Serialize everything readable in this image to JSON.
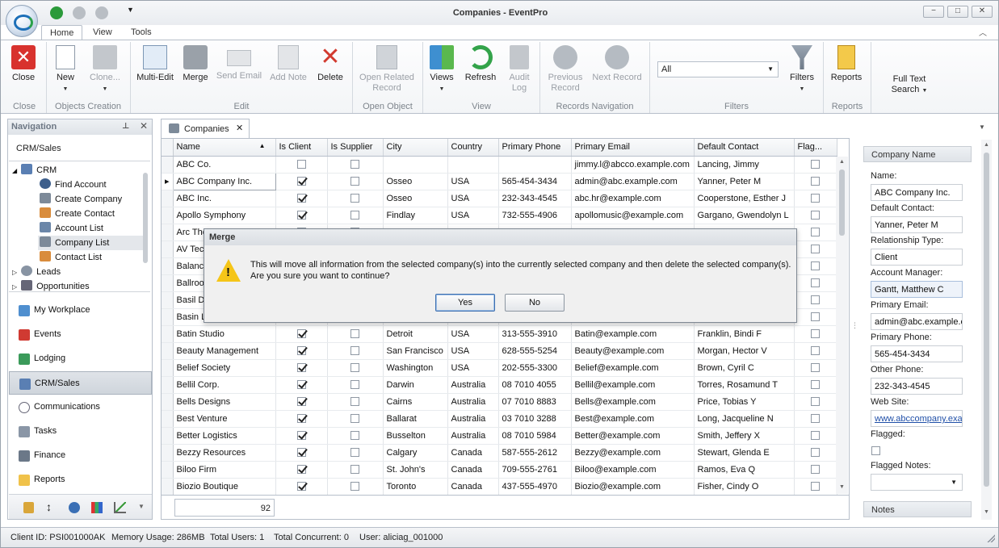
{
  "window": {
    "title": "Companies - EventPro",
    "minimize": "−",
    "restore": "□",
    "close": "✕"
  },
  "ribbon_tabs": [
    "Home",
    "View",
    "Tools"
  ],
  "ribbon": {
    "close": "Close",
    "new": "New",
    "clone": "Clone...",
    "multi_edit": "Multi-Edit",
    "merge": "Merge",
    "send_email": "Send Email",
    "add_note": "Add Note",
    "delete": "Delete",
    "open_related_1": "Open Related",
    "open_related_2": "Record",
    "views": "Views",
    "refresh": "Refresh",
    "audit_1": "Audit",
    "audit_2": "Log",
    "prev_1": "Previous",
    "prev_2": "Record",
    "next_1": "Next Record",
    "filter_value": "All",
    "filters": "Filters",
    "reports": "Reports",
    "fts_1": "Full Text",
    "fts_2": "Search",
    "groups": {
      "close": "Close",
      "objects": "Objects Creation",
      "edit": "Edit",
      "open": "Open Object",
      "view": "View",
      "nav": "Records Navigation",
      "filters": "Filters",
      "reports": "Reports"
    }
  },
  "navigation": {
    "title": "Navigation",
    "section": "CRM/Sales",
    "tree": {
      "crm": "CRM",
      "find_account": "Find Account",
      "create_company": "Create Company",
      "create_contact": "Create Contact",
      "account_list": "Account List",
      "company_list": "Company List",
      "contact_list": "Contact List",
      "leads": "Leads",
      "opportunities": "Opportunities"
    },
    "buttons": {
      "workplace": "My Workplace",
      "events": "Events",
      "lodging": "Lodging",
      "crm": "CRM/Sales",
      "communications": "Communications",
      "tasks": "Tasks",
      "finance": "Finance",
      "reports": "Reports"
    }
  },
  "doc_tab": "Companies",
  "grid": {
    "columns": [
      "Name",
      "Is Client",
      "Is Supplier",
      "City",
      "Country",
      "Primary Phone",
      "Primary Email",
      "Default Contact",
      "Flag..."
    ],
    "rows": [
      {
        "name": "ABC Co.",
        "client": false,
        "supplier": false,
        "city": "",
        "country": "",
        "phone": "",
        "email": "jimmy.l@abcco.example.com",
        "contact": "Lancing, Jimmy"
      },
      {
        "name": "ABC Company Inc.",
        "client": true,
        "supplier": false,
        "city": "Osseo",
        "country": "USA",
        "phone": "565-454-3434",
        "email": "admin@abc.example.com",
        "contact": "Yanner, Peter M"
      },
      {
        "name": "ABC Inc.",
        "client": true,
        "supplier": false,
        "city": "Osseo",
        "country": "USA",
        "phone": "232-343-4545",
        "email": "abc.hr@example.com",
        "contact": "Cooperstone, Esther J"
      },
      {
        "name": "Apollo Symphony",
        "client": true,
        "supplier": false,
        "city": "Findlay",
        "country": "USA",
        "phone": "732-555-4906",
        "email": "apollomusic@example.com",
        "contact": "Gargano, Gwendolyn L"
      },
      {
        "name": "Arc The",
        "client": true,
        "supplier": false,
        "city": "",
        "country": "",
        "phone": "",
        "email": "",
        "contact": ""
      },
      {
        "name": "AV Tec",
        "client": true,
        "supplier": false,
        "city": "",
        "country": "",
        "phone": "",
        "email": "",
        "contact": ""
      },
      {
        "name": "Balance",
        "client": true,
        "supplier": false,
        "city": "",
        "country": "",
        "phone": "",
        "email": "",
        "contact": ""
      },
      {
        "name": "Ballroo",
        "client": true,
        "supplier": false,
        "city": "",
        "country": "",
        "phone": "",
        "email": "",
        "contact": ""
      },
      {
        "name": "Basil De",
        "client": true,
        "supplier": false,
        "city": "",
        "country": "",
        "phone": "",
        "email": "",
        "contact": ""
      },
      {
        "name": "Basin L",
        "client": true,
        "supplier": false,
        "city": "",
        "country": "",
        "phone": "",
        "email": "",
        "contact": ""
      },
      {
        "name": "Batin Studio",
        "client": true,
        "supplier": false,
        "city": "Detroit",
        "country": "USA",
        "phone": "313-555-3910",
        "email": "Batin@example.com",
        "contact": "Franklin, Bindi F"
      },
      {
        "name": "Beauty Management",
        "client": true,
        "supplier": false,
        "city": "San Francisco",
        "country": "USA",
        "phone": "628-555-5254",
        "email": "Beauty@example.com",
        "contact": "Morgan, Hector V"
      },
      {
        "name": "Belief Society",
        "client": true,
        "supplier": false,
        "city": "Washington",
        "country": "USA",
        "phone": "202-555-3300",
        "email": "Belief@example.com",
        "contact": "Brown, Cyril C"
      },
      {
        "name": "Bellil Corp.",
        "client": true,
        "supplier": false,
        "city": "Darwin",
        "country": "Australia",
        "phone": "08 7010 4055",
        "email": "Bellil@example.com",
        "contact": "Torres, Rosamund T"
      },
      {
        "name": "Bells Designs",
        "client": true,
        "supplier": false,
        "city": "Cairns",
        "country": "Australia",
        "phone": "07 7010 8883",
        "email": "Bells@example.com",
        "contact": "Price, Tobias Y"
      },
      {
        "name": "Best Venture",
        "client": true,
        "supplier": false,
        "city": "Ballarat",
        "country": "Australia",
        "phone": "03 7010 3288",
        "email": "Best@example.com",
        "contact": "Long, Jacqueline N"
      },
      {
        "name": "Better Logistics",
        "client": true,
        "supplier": false,
        "city": "Busselton",
        "country": "Australia",
        "phone": "08 7010 5984",
        "email": "Better@example.com",
        "contact": "Smith, Jeffery X"
      },
      {
        "name": "Bezzy Resources",
        "client": true,
        "supplier": false,
        "city": "Calgary",
        "country": "Canada",
        "phone": "587-555-2612",
        "email": "Bezzy@example.com",
        "contact": "Stewart, Glenda E"
      },
      {
        "name": "Biloo Firm",
        "client": true,
        "supplier": false,
        "city": "St. John's",
        "country": "Canada",
        "phone": "709-555-2761",
        "email": "Biloo@example.com",
        "contact": "Ramos, Eva Q"
      },
      {
        "name": "Biozio Boutique",
        "client": true,
        "supplier": false,
        "city": "Toronto",
        "country": "Canada",
        "phone": "437-555-4970",
        "email": "Biozio@example.com",
        "contact": "Fisher, Cindy O"
      }
    ],
    "count": "92"
  },
  "detail": {
    "header": "Company Name",
    "name_label": "Name:",
    "name": "ABC Company Inc.",
    "contact_label": "Default Contact:",
    "contact": "Yanner, Peter M",
    "rel_label": "Relationship Type:",
    "rel": "Client",
    "mgr_label": "Account Manager:",
    "mgr": "Gantt, Matthew C",
    "email_label": "Primary Email:",
    "email": "admin@abc.example.com",
    "phone_label": "Primary Phone:",
    "phone": "565-454-3434",
    "other_label": "Other Phone:",
    "other": "232-343-4545",
    "web_label": "Web Site:",
    "web": "www.abccompany.example.com",
    "flagged_label": "Flagged:",
    "flag_notes_label": "Flagged Notes:",
    "notes_header": "Notes"
  },
  "dialog": {
    "title": "Merge",
    "line1": "This will move all information from the selected company(s) into the currently selected company and then delete the selected company(s).",
    "line2": "Are you sure you want to continue?",
    "yes": "Yes",
    "no": "No"
  },
  "status": {
    "client_id": "Client ID: PSI001000AK",
    "memory": "Memory Usage: 286MB",
    "users": "Total Users: 1",
    "concurrent": "Total Concurrent: 0",
    "user": "User: aliciag_001000"
  }
}
